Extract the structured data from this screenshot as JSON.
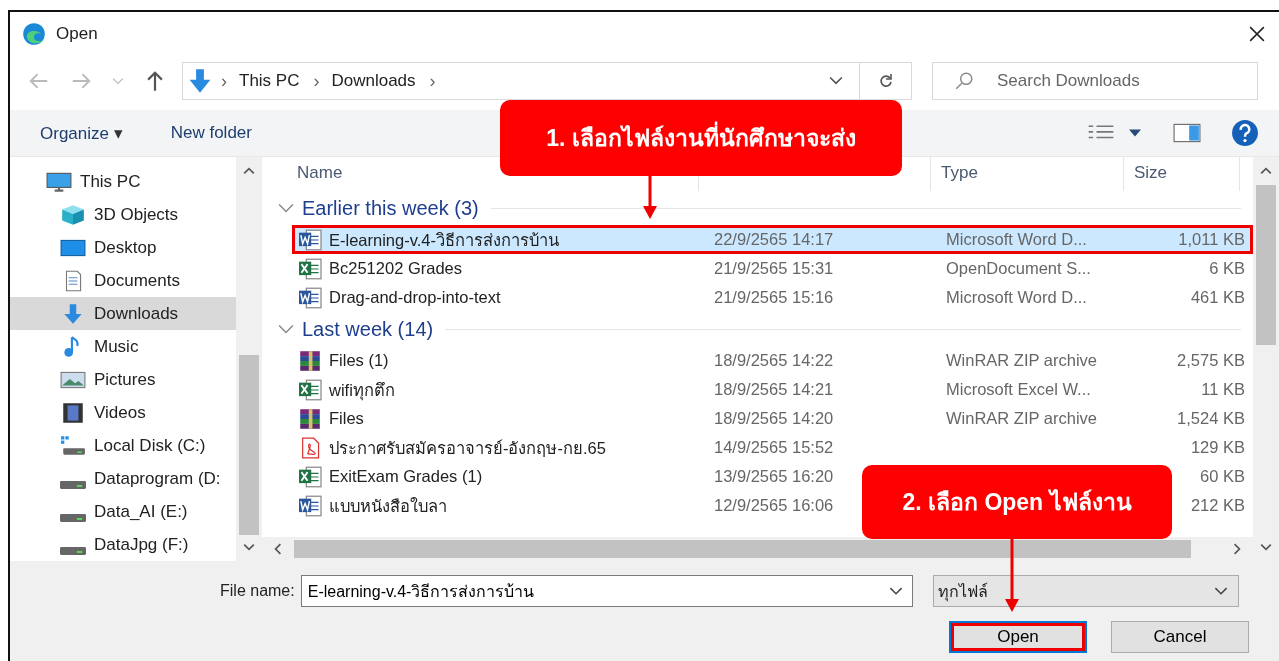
{
  "window": {
    "title": "Open"
  },
  "address": {
    "path": [
      "This PC",
      "Downloads"
    ],
    "separator": "›"
  },
  "search": {
    "placeholder": "Search Downloads"
  },
  "toolbar": {
    "organize": "Organize",
    "organize_caret": "▾",
    "new_folder": "New folder"
  },
  "sidebar": {
    "items": [
      {
        "label": "This PC",
        "kind": "pc",
        "selected": false,
        "children": [
          {
            "label": "3D Objects",
            "kind": "cube",
            "selected": false
          },
          {
            "label": "Desktop",
            "kind": "desktop",
            "selected": false
          },
          {
            "label": "Documents",
            "kind": "docs",
            "selected": false
          },
          {
            "label": "Downloads",
            "kind": "download",
            "selected": true
          },
          {
            "label": "Music",
            "kind": "music",
            "selected": false
          },
          {
            "label": "Pictures",
            "kind": "pictures",
            "selected": false
          },
          {
            "label": "Videos",
            "kind": "videos",
            "selected": false
          },
          {
            "label": "Local Disk (C:)",
            "kind": "sysdisk",
            "selected": false
          },
          {
            "label": "Dataprogram (D:",
            "kind": "disk",
            "selected": false
          },
          {
            "label": "Data_AI (E:)",
            "kind": "disk",
            "selected": false
          },
          {
            "label": "DataJpg (F:)",
            "kind": "disk",
            "selected": false
          }
        ]
      }
    ]
  },
  "columns": [
    "Name",
    "",
    "Type",
    "Size"
  ],
  "groups": [
    {
      "label": "Earlier this week (3)",
      "expanded": true,
      "rows": [
        {
          "name": "E-learning-v.4-วิธีการส่งการบ้าน",
          "kind": "word",
          "date": "22/9/2565 14:17",
          "type": "Microsoft Word D...",
          "size": "1,011 KB",
          "selected": true,
          "highlighted": true
        },
        {
          "name": "Bc251202 Grades",
          "kind": "excel",
          "date": "21/9/2565 15:31",
          "type": "OpenDocument S...",
          "size": "6 KB",
          "selected": false
        },
        {
          "name": "Drag-and-drop-into-text",
          "kind": "word",
          "date": "21/9/2565 15:16",
          "type": "Microsoft Word D...",
          "size": "461 KB",
          "selected": false
        }
      ]
    },
    {
      "label": "Last week (14)",
      "expanded": true,
      "rows": [
        {
          "name": "Files (1)",
          "kind": "rar",
          "date": "18/9/2565 14:22",
          "type": "WinRAR ZIP archive",
          "size": "2,575 KB",
          "selected": false
        },
        {
          "name": "wifiทุกตึก",
          "kind": "excel",
          "date": "18/9/2565 14:21",
          "type": "Microsoft Excel W...",
          "size": "11 KB",
          "selected": false
        },
        {
          "name": "Files",
          "kind": "rar",
          "date": "18/9/2565 14:20",
          "type": "WinRAR ZIP archive",
          "size": "1,524 KB",
          "selected": false
        },
        {
          "name": "ประกาศรับสมัครอาจารย์-อังกฤษ-กย.65",
          "kind": "pdf",
          "date": "14/9/2565 15:52",
          "type": "",
          "size": "129 KB",
          "selected": false
        },
        {
          "name": "ExitExam Grades (1)",
          "kind": "excel",
          "date": "13/9/2565 16:20",
          "type": "",
          "size": "60 KB",
          "selected": false
        },
        {
          "name": "แบบหนังสือใบลา",
          "kind": "word",
          "date": "12/9/2565 16:06",
          "type": "",
          "size": "212 KB",
          "selected": false
        }
      ]
    }
  ],
  "file_name": {
    "label": "File name:",
    "value": "E-learning-v.4-วิธีการส่งการบ้าน"
  },
  "file_type": {
    "value": "ทุกไฟล์"
  },
  "buttons": [
    {
      "label": "Open",
      "kind": "primary",
      "highlighted": true
    },
    {
      "label": "Cancel",
      "kind": "normal",
      "highlighted": false
    }
  ],
  "callouts": [
    {
      "text": "1. เลือกไฟล์งานที่นักศึกษาจะส่ง"
    },
    {
      "text": "2. เลือก Open ไฟล์งาน"
    }
  ]
}
